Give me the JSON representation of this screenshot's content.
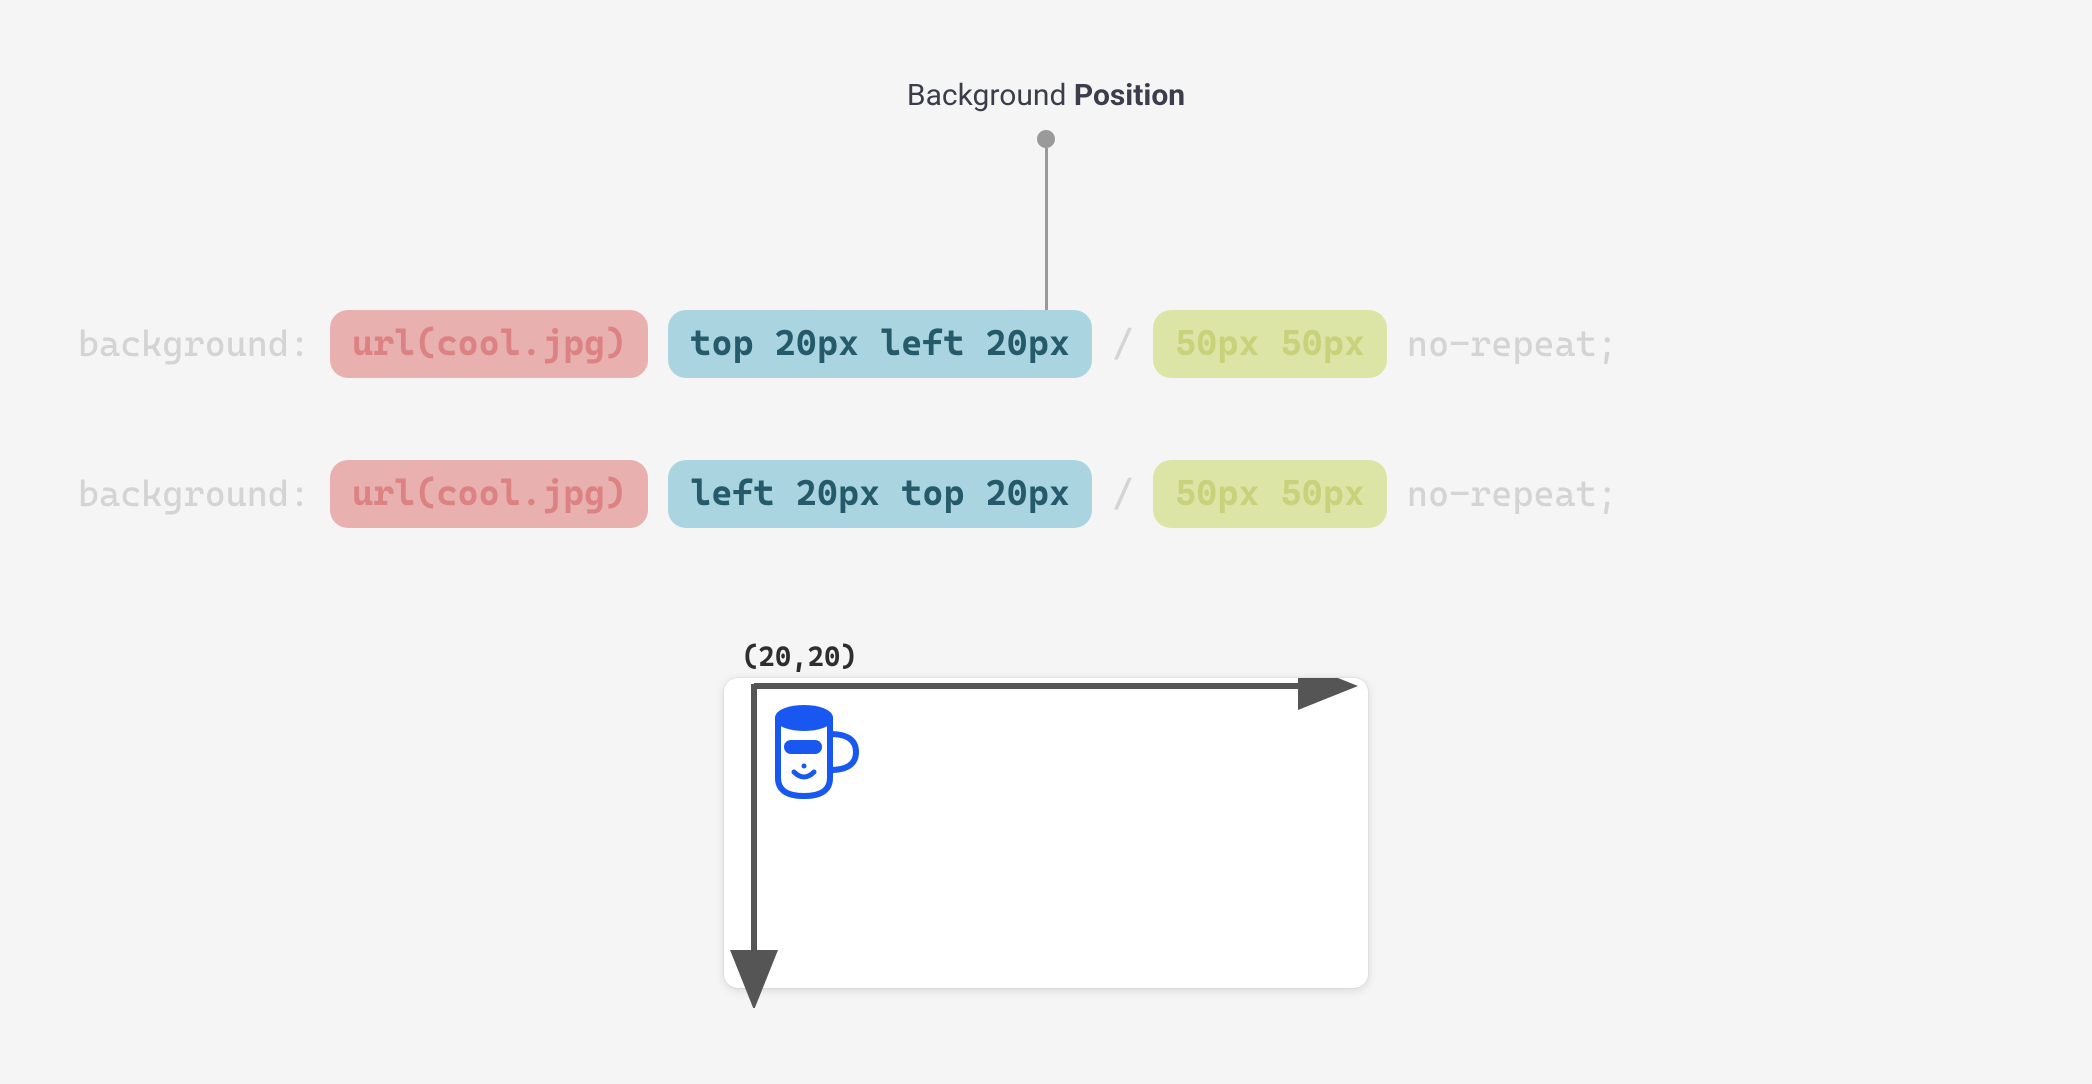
{
  "title": {
    "prefix": "Background ",
    "emphasis": "Position"
  },
  "code": {
    "property": "background:",
    "line1": {
      "image": "url(cool.jpg)",
      "position": "top 20px left 20px",
      "size": "50px 50px",
      "repeat": "no-repeat;"
    },
    "line2": {
      "image": "url(cool.jpg)",
      "position": "left 20px top 20px",
      "size": "50px 50px",
      "repeat": "no-repeat;"
    },
    "separator": "/"
  },
  "preview": {
    "coord_label": "(20,20)"
  },
  "colors": {
    "pill_red_bg": "#e9b0b0",
    "pill_blue_bg": "#aad5e0",
    "pill_green_bg": "#dde5a6",
    "faded_text": "#d4d4d4",
    "connector": "#9a9a9a",
    "arrow": "#555555",
    "icon": "#1857f0"
  }
}
